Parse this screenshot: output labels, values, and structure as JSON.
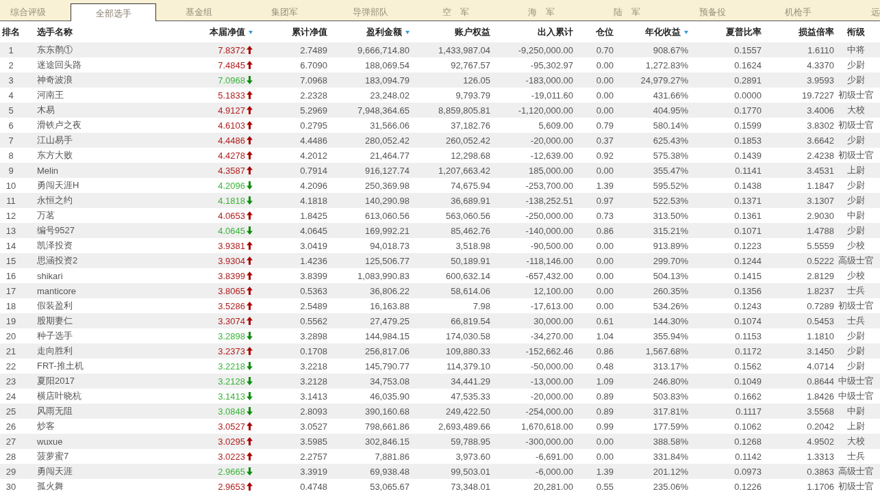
{
  "tabs": [
    {
      "label": "综合评级",
      "selected": false
    },
    {
      "label": "全部选手",
      "selected": true
    },
    {
      "label": "基金组",
      "selected": false
    },
    {
      "label": "集团军",
      "selected": false
    },
    {
      "label": "导弹部队",
      "selected": false
    },
    {
      "label": "空　军",
      "selected": false
    },
    {
      "label": "海　军",
      "selected": false
    },
    {
      "label": "陆　军",
      "selected": false
    },
    {
      "label": "预备役",
      "selected": false
    },
    {
      "label": "机枪手",
      "selected": false
    },
    {
      "label": "远",
      "selected": false
    }
  ],
  "table": {
    "columns": [
      {
        "label": "排名"
      },
      {
        "label": "选手名称"
      },
      {
        "label": "本届净值",
        "sort_indicator": true
      },
      {
        "label": "累计净值"
      },
      {
        "label": "盈利金额",
        "sort_indicator": true
      },
      {
        "label": "账户权益"
      },
      {
        "label": "出入累计"
      },
      {
        "label": "仓位"
      },
      {
        "label": "年化收益",
        "sort_indicator": true
      },
      {
        "label": "夏普比率"
      },
      {
        "label": "损益倍率"
      },
      {
        "label": "衔级"
      }
    ],
    "rows": [
      {
        "rising": true,
        "cells": [
          "1",
          "东东鹡①",
          "7.8372",
          "2.7489",
          "9,666,714.80",
          "1,433,987.04",
          "-9,250,000.00",
          "0.70",
          "908.67%",
          "0.1557",
          "1.6110",
          "中将"
        ]
      },
      {
        "rising": true,
        "cells": [
          "2",
          "迷途回头路",
          "7.4845",
          "6.7090",
          "188,069.54",
          "92,767.57",
          "-95,302.97",
          "0.00",
          "1,272.83%",
          "0.1624",
          "4.3370",
          "少尉"
        ]
      },
      {
        "rising": false,
        "cells": [
          "3",
          "神奇波浪",
          "7.0968",
          "7.0968",
          "183,094.79",
          "126.05",
          "-183,000.00",
          "0.00",
          "24,979.27%",
          "0.2891",
          "3.9593",
          "少尉"
        ]
      },
      {
        "rising": true,
        "cells": [
          "4",
          "河南王",
          "5.1833",
          "2.2328",
          "23,248.02",
          "9,793.79",
          "-19,011.60",
          "0.00",
          "431.66%",
          "0.0000",
          "19.7227",
          "初级士官"
        ]
      },
      {
        "rising": true,
        "cells": [
          "5",
          "木易",
          "4.9127",
          "5.2969",
          "7,948,364.65",
          "8,859,805.81",
          "-1,120,000.00",
          "0.00",
          "404.95%",
          "0.1770",
          "3.4006",
          "大校"
        ]
      },
      {
        "rising": true,
        "cells": [
          "6",
          "滑铁卢之夜",
          "4.6103",
          "0.2795",
          "31,566.06",
          "37,182.76",
          "5,609.00",
          "0.79",
          "580.14%",
          "0.1599",
          "3.8302",
          "初级士官"
        ]
      },
      {
        "rising": true,
        "cells": [
          "7",
          "江山易手",
          "4.4486",
          "4.4486",
          "280,052.42",
          "260,052.42",
          "-20,000.00",
          "0.37",
          "625.43%",
          "0.1853",
          "3.6642",
          "少尉"
        ]
      },
      {
        "rising": true,
        "cells": [
          "8",
          "东方大败",
          "4.4278",
          "4.2012",
          "21,464.77",
          "12,298.68",
          "-12,639.00",
          "0.92",
          "575.38%",
          "0.1439",
          "2.4238",
          "初级士官"
        ]
      },
      {
        "rising": true,
        "cells": [
          "9",
          "Melin",
          "4.3587",
          "0.7914",
          "916,127.74",
          "1,207,663.42",
          "185,000.00",
          "0.00",
          "355.47%",
          "0.1141",
          "3.4531",
          "上尉"
        ]
      },
      {
        "rising": false,
        "cells": [
          "10",
          "勇闯天涯H",
          "4.2096",
          "4.2096",
          "250,369.98",
          "74,675.94",
          "-253,700.00",
          "1.39",
          "595.52%",
          "0.1438",
          "1.1847",
          "少尉"
        ]
      },
      {
        "rising": false,
        "cells": [
          "11",
          "永恒之约",
          "4.1818",
          "4.1818",
          "140,290.98",
          "36,689.91",
          "-138,252.51",
          "0.97",
          "522.53%",
          "0.1371",
          "3.1307",
          "少尉"
        ]
      },
      {
        "rising": true,
        "cells": [
          "12",
          "万茗",
          "4.0653",
          "1.8425",
          "613,060.56",
          "563,060.56",
          "-250,000.00",
          "0.73",
          "313.50%",
          "0.1361",
          "2.9030",
          "中尉"
        ]
      },
      {
        "rising": false,
        "cells": [
          "13",
          "编号9527",
          "4.0645",
          "4.0645",
          "169,992.21",
          "85,462.76",
          "-140,000.00",
          "0.86",
          "315.21%",
          "0.1071",
          "1.4788",
          "少尉"
        ]
      },
      {
        "rising": true,
        "cells": [
          "14",
          "凯泽投资",
          "3.9381",
          "3.0419",
          "94,018.73",
          "3,518.98",
          "-90,500.00",
          "0.00",
          "913.89%",
          "0.1223",
          "5.5559",
          "少校"
        ]
      },
      {
        "rising": true,
        "cells": [
          "15",
          "思涵投资2",
          "3.9304",
          "1.4236",
          "125,506.77",
          "50,189.91",
          "-118,146.00",
          "0.00",
          "299.70%",
          "0.1244",
          "0.5222",
          "高级士官"
        ]
      },
      {
        "rising": true,
        "cells": [
          "16",
          "shikari",
          "3.8399",
          "3.8399",
          "1,083,990.83",
          "600,632.14",
          "-657,432.00",
          "0.00",
          "504.13%",
          "0.1415",
          "2.8129",
          "少校"
        ]
      },
      {
        "rising": true,
        "cells": [
          "17",
          "manticore",
          "3.8065",
          "0.5363",
          "36,806.22",
          "58,614.06",
          "12,100.00",
          "0.00",
          "260.35%",
          "0.1356",
          "1.8237",
          "士兵"
        ]
      },
      {
        "rising": true,
        "cells": [
          "18",
          "假装盈利",
          "3.5286",
          "2.5489",
          "16,163.88",
          "7.98",
          "-17,613.00",
          "0.00",
          "534.26%",
          "0.1243",
          "0.7289",
          "初级士官"
        ]
      },
      {
        "rising": true,
        "cells": [
          "19",
          "股期妻仁",
          "3.3074",
          "0.5562",
          "27,479.25",
          "66,819.54",
          "30,000.00",
          "0.61",
          "144.30%",
          "0.1074",
          "0.5453",
          "士兵"
        ]
      },
      {
        "rising": false,
        "cells": [
          "20",
          "种子选手",
          "3.2898",
          "3.2898",
          "144,984.15",
          "174,030.58",
          "-34,270.00",
          "1.04",
          "355.94%",
          "0.1153",
          "1.1810",
          "少尉"
        ]
      },
      {
        "rising": true,
        "cells": [
          "21",
          "走向胜利",
          "3.2373",
          "0.1708",
          "256,817.06",
          "109,880.33",
          "-152,662.46",
          "0.86",
          "1,567.68%",
          "0.1172",
          "3.1450",
          "少尉"
        ]
      },
      {
        "rising": false,
        "cells": [
          "22",
          "FRT-推土机",
          "3.2218",
          "3.2218",
          "145,790.77",
          "114,379.10",
          "-50,000.00",
          "0.48",
          "313.17%",
          "0.1562",
          "4.0714",
          "少尉"
        ]
      },
      {
        "rising": false,
        "cells": [
          "23",
          "夏阳2017",
          "3.2128",
          "3.2128",
          "34,753.08",
          "34,441.29",
          "-13,000.00",
          "1.09",
          "246.80%",
          "0.1049",
          "0.8644",
          "中级士官"
        ]
      },
      {
        "rising": false,
        "cells": [
          "24",
          "横店叶晓杭",
          "3.1413",
          "3.1413",
          "46,035.90",
          "47,535.33",
          "-20,000.00",
          "0.89",
          "503.83%",
          "0.1662",
          "1.8426",
          "中级士官"
        ]
      },
      {
        "rising": false,
        "cells": [
          "25",
          "风雨无阻",
          "3.0848",
          "2.8093",
          "390,160.68",
          "249,422.50",
          "-254,000.00",
          "0.89",
          "317.81%",
          "0.1117",
          "3.5568",
          "中尉"
        ]
      },
      {
        "rising": true,
        "cells": [
          "26",
          "炒客",
          "3.0527",
          "3.0527",
          "798,661.86",
          "2,693,489.66",
          "1,670,618.00",
          "0.99",
          "177.59%",
          "0.1062",
          "0.2042",
          "上尉"
        ]
      },
      {
        "rising": true,
        "cells": [
          "27",
          "wuxue",
          "3.0295",
          "3.5985",
          "302,846.15",
          "59,788.95",
          "-300,000.00",
          "0.00",
          "388.58%",
          "0.1268",
          "4.9502",
          "大校"
        ]
      },
      {
        "rising": true,
        "cells": [
          "28",
          "菠萝蜜7",
          "3.0223",
          "2.2757",
          "7,881.86",
          "3,973.60",
          "-6,691.00",
          "0.00",
          "331.84%",
          "0.1142",
          "1.3313",
          "士兵"
        ]
      },
      {
        "rising": false,
        "cells": [
          "29",
          "勇闯天涯",
          "2.9665",
          "3.3919",
          "69,938.48",
          "99,503.01",
          "-6,000.00",
          "1.39",
          "201.12%",
          "0.0973",
          "0.3863",
          "高级士官"
        ]
      },
      {
        "rising": true,
        "cells": [
          "30",
          "孤火舞",
          "2.9653",
          "0.4748",
          "53,065.67",
          "73,348.01",
          "20,281.00",
          "0.55",
          "235.06%",
          "0.1226",
          "1.1706",
          "初级士官"
        ]
      }
    ]
  }
}
